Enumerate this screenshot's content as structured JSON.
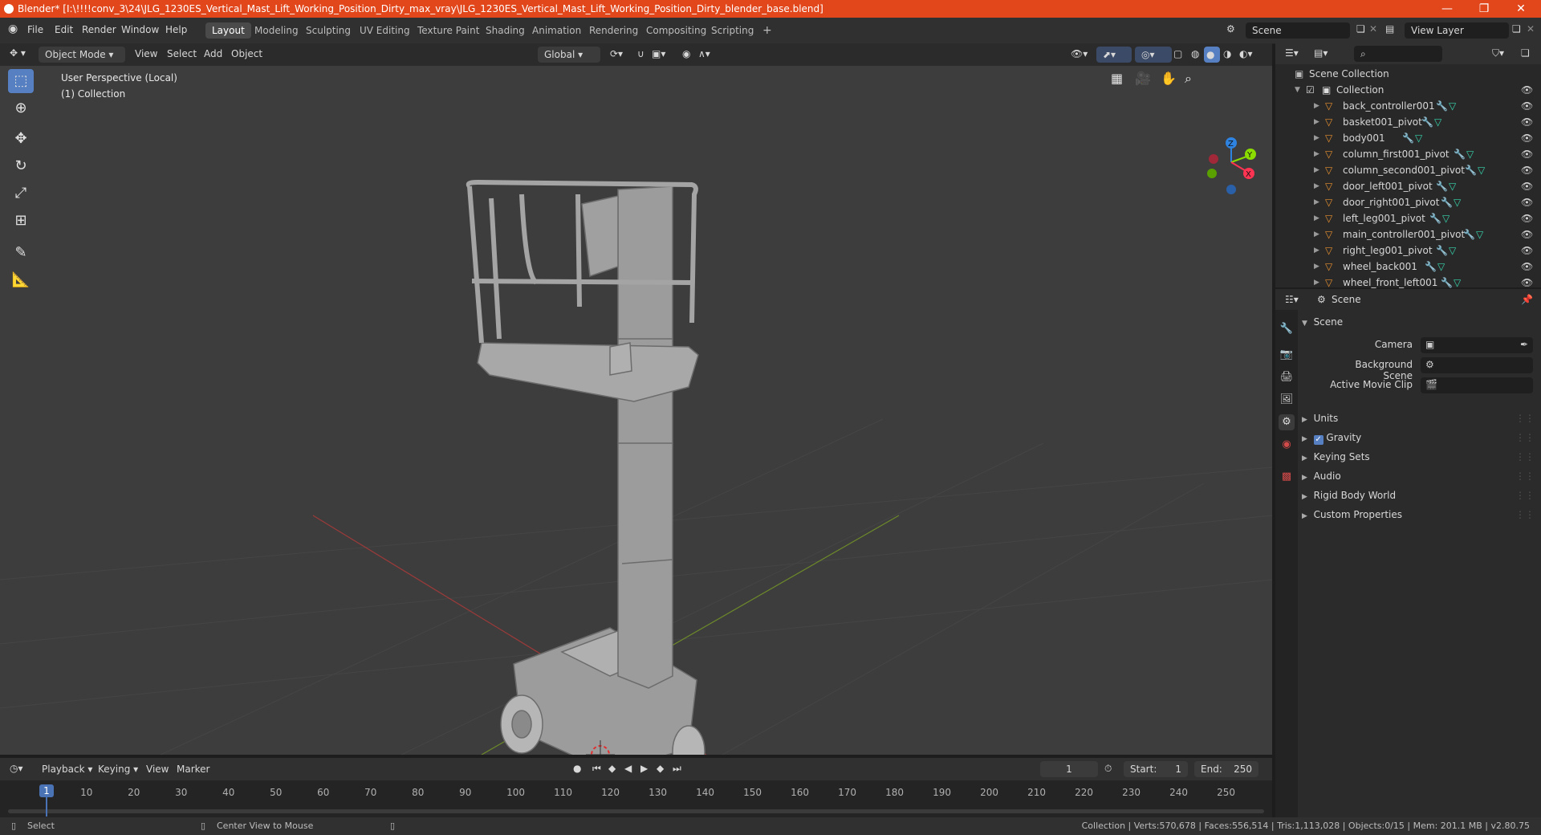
{
  "window": {
    "title": "Blender* [I:\\!!!!conv_3\\24\\JLG_1230ES_Vertical_Mast_Lift_Working_Position_Dirty_max_vray\\JLG_1230ES_Vertical_Mast_Lift_Working_Position_Dirty_blender_base.blend]",
    "minimize": "—",
    "maximize": "❐",
    "close": "✕"
  },
  "menubar": {
    "items": [
      "File",
      "Edit",
      "Render",
      "Window",
      "Help"
    ],
    "workspaces": [
      "Layout",
      "Modeling",
      "Sculpting",
      "UV Editing",
      "Texture Paint",
      "Shading",
      "Animation",
      "Rendering",
      "Compositing",
      "Scripting"
    ],
    "active_workspace": "Layout",
    "add_workspace": "+",
    "scene_label": "Scene",
    "view_layer_label": "View Layer"
  },
  "viewport_header": {
    "mode": "Object Mode",
    "menus": [
      "View",
      "Select",
      "Add",
      "Object"
    ],
    "transform_orientation": "Global"
  },
  "viewport": {
    "perspective_label": "User Perspective (Local)",
    "collection_label": "(1) Collection",
    "gizmo_axes": {
      "z": "Z",
      "y": "Y",
      "x": "X"
    },
    "axis_colors": {
      "x": "#ff3352",
      "y": "#8bdc00",
      "z": "#2f83e0"
    }
  },
  "outliner": {
    "root": "Scene Collection",
    "collection": "Collection",
    "objects": [
      "back_controller001",
      "basket001_pivot",
      "body001",
      "column_first001_pivot",
      "column_second001_pivot",
      "door_left001_pivot",
      "door_right001_pivot",
      "left_leg001_pivot",
      "main_controller001_pivot",
      "right_leg001_pivot",
      "wheel_back001",
      "wheel_front_left001"
    ]
  },
  "properties": {
    "header": "Scene",
    "panel": "Scene",
    "fields": [
      {
        "label": "Camera"
      },
      {
        "label": "Background Scene"
      },
      {
        "label": "Active Movie Clip"
      }
    ],
    "sections": [
      "Units",
      "Gravity",
      "Keying Sets",
      "Audio",
      "Rigid Body World",
      "Custom Properties"
    ],
    "gravity_checked": true
  },
  "timeline": {
    "menus": [
      "Playback",
      "Keying",
      "View",
      "Marker"
    ],
    "current_frame": "1",
    "start_label": "Start:",
    "start": "1",
    "end_label": "End:",
    "end": "250",
    "ruler": [
      "1",
      "10",
      "20",
      "30",
      "40",
      "50",
      "60",
      "70",
      "80",
      "90",
      "100",
      "110",
      "120",
      "130",
      "140",
      "150",
      "160",
      "170",
      "180",
      "190",
      "200",
      "210",
      "220",
      "230",
      "240",
      "250"
    ]
  },
  "statusbar": {
    "left_action": "Select",
    "middle_action": "Center View to Mouse",
    "stats": "Collection | Verts:570,678 | Faces:556,514 | Tris:1,113,028 | Objects:0/15 | Mem: 201.1 MB | v2.80.75"
  }
}
